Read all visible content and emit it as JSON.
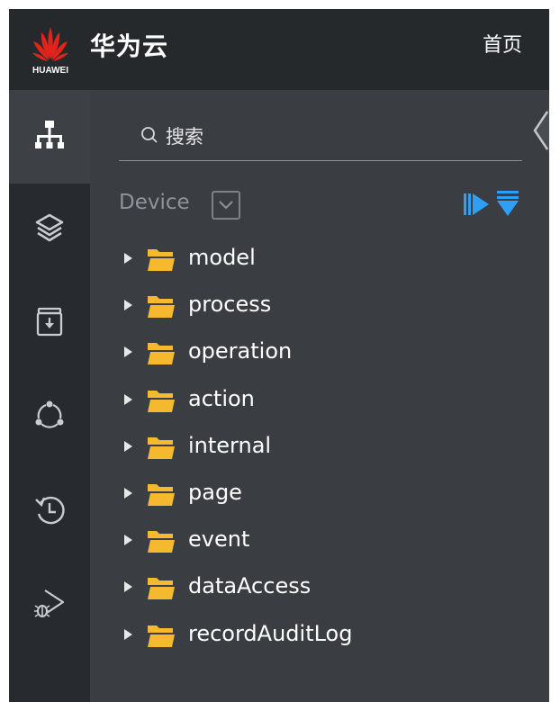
{
  "header": {
    "logo_text": "HUAWEI",
    "brand": "华为云",
    "home_link": "首页"
  },
  "activity_bar": {
    "items": [
      {
        "icon": "sitemap-icon",
        "active": true
      },
      {
        "icon": "layers-icon",
        "active": false
      },
      {
        "icon": "archive-download-icon",
        "active": false
      },
      {
        "icon": "nodes-cycle-icon",
        "active": false
      },
      {
        "icon": "history-icon",
        "active": false
      },
      {
        "icon": "debug-run-icon",
        "active": false
      }
    ]
  },
  "sidebar": {
    "search": {
      "placeholder": "搜索",
      "value": ""
    },
    "section": {
      "label": "Device"
    },
    "tree": [
      {
        "label": "model"
      },
      {
        "label": "process"
      },
      {
        "label": "operation"
      },
      {
        "label": "action"
      },
      {
        "label": "internal"
      },
      {
        "label": "page"
      },
      {
        "label": "event"
      },
      {
        "label": "dataAccess"
      },
      {
        "label": "recordAuditLog"
      }
    ]
  },
  "colors": {
    "topbar": "#26292c",
    "activity_bar": "#272a2e",
    "side_panel": "#3a3e43",
    "accent_blue": "#2f9ff5",
    "folder_yellow": "#f5b82e",
    "logo_red": "#e1241b"
  }
}
